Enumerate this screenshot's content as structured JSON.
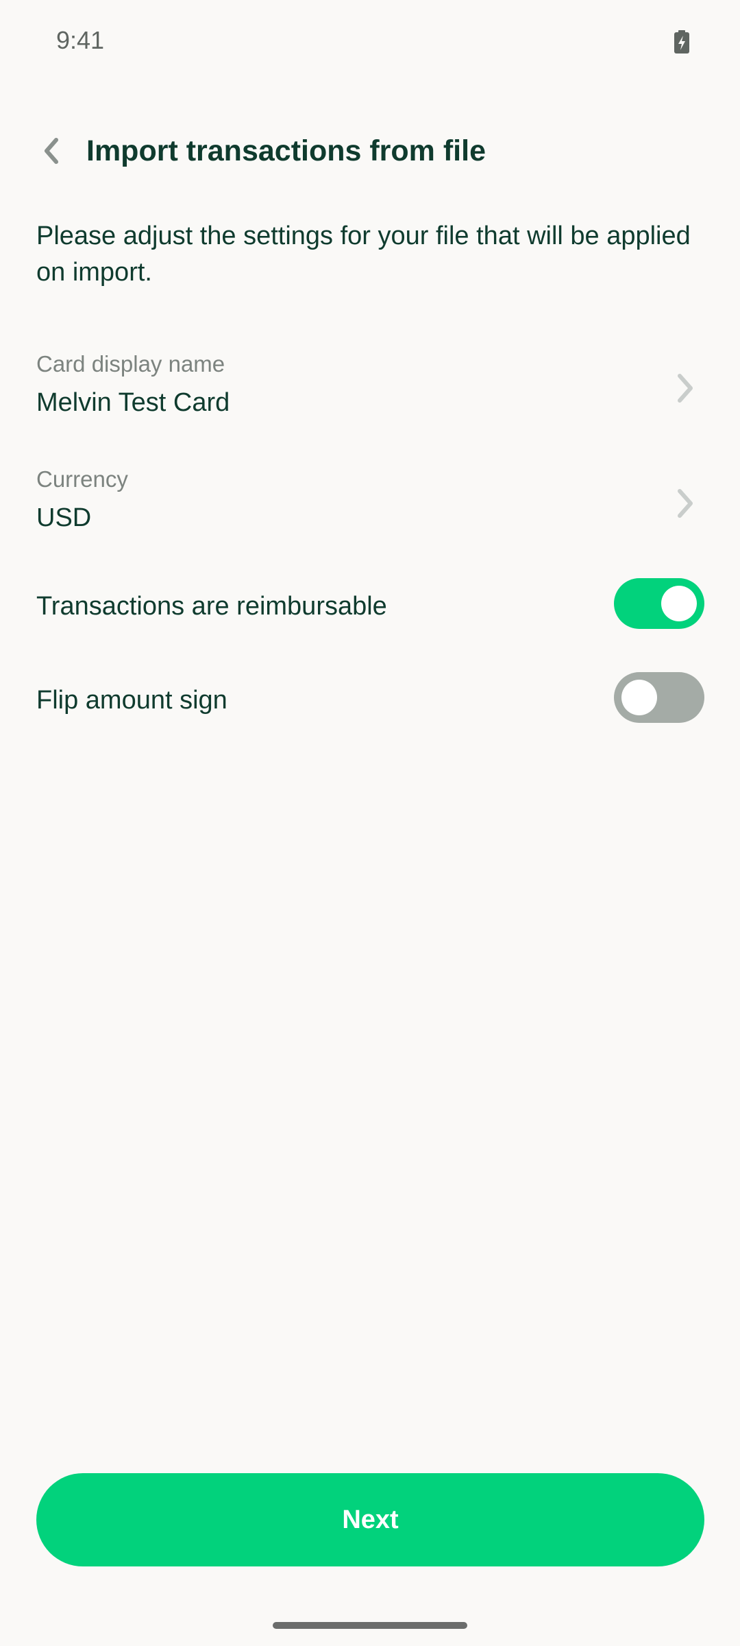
{
  "status_bar": {
    "time": "9:41",
    "battery_icon": "battery-charging-icon"
  },
  "header": {
    "back_icon": "chevron-left-icon",
    "title": "Import transactions from file"
  },
  "intro": {
    "text": "Please adjust the settings for your file that will be applied on import."
  },
  "settings": {
    "card_name": {
      "label": "Card display name",
      "value": "Melvin Test Card",
      "icon": "chevron-right-icon"
    },
    "currency": {
      "label": "Currency",
      "value": "USD",
      "icon": "chevron-right-icon"
    }
  },
  "toggles": {
    "reimbursable": {
      "label": "Transactions are reimbursable",
      "on": true
    },
    "flip_sign": {
      "label": "Flip amount sign",
      "on": false
    }
  },
  "footer": {
    "next_label": "Next"
  },
  "colors": {
    "accent": "#02d27c",
    "text_primary": "#0f3b2e",
    "text_secondary": "#7c837f",
    "toggle_off": "#a4aba6",
    "background": "#faf9f7"
  }
}
